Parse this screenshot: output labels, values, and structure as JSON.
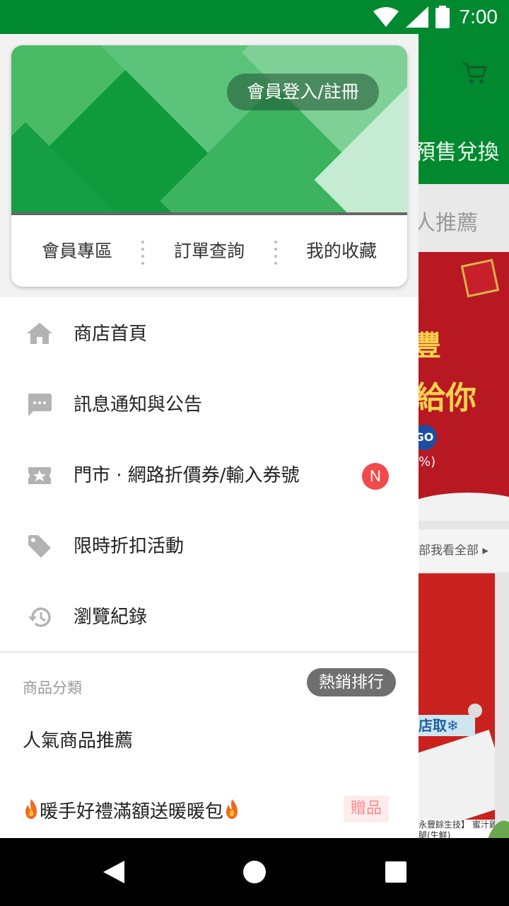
{
  "status_bar": {
    "time": "7:00",
    "icons": [
      "wifi-icon",
      "signal-icon",
      "battery-icon"
    ]
  },
  "background_app": {
    "tab_label_partial": "預售兌換",
    "section_title_partial": "人推薦",
    "banner_text_1": "豐",
    "banner_text_2": "給你",
    "banner_badge": "GO",
    "banner_pct": "%)",
    "view_all": "部我看全部 ▸",
    "product_tag": "店取❄",
    "product_caption": "永豐餘生技】 蜜汁雞腿(生鮮)"
  },
  "drawer": {
    "login_button": "會員登入/註冊",
    "quick_links": [
      "會員專區",
      "訂單查詢",
      "我的收藏"
    ],
    "menu": [
      {
        "label": "商店首頁",
        "icon": "home-icon"
      },
      {
        "label": "訊息通知與公告",
        "icon": "message-icon"
      },
      {
        "label": "門市 · 網路折價券/輸入券號",
        "icon": "coupon-icon",
        "badge": "N"
      },
      {
        "label": "限時折扣活動",
        "icon": "tag-icon"
      },
      {
        "label": "瀏覽紀錄",
        "icon": "history-icon"
      }
    ],
    "category_header": "商品分類",
    "hot_button": "熱銷排行",
    "categories": [
      {
        "label": "人氣商品推薦"
      },
      {
        "label": "暖手好禮滿額送暖暖包",
        "badge": "贈品",
        "icon": "flame-icon"
      }
    ]
  },
  "colors": {
    "brand_green": "#00892f",
    "badge_red": "#f04a4a",
    "header_green": "#1ea84b"
  }
}
